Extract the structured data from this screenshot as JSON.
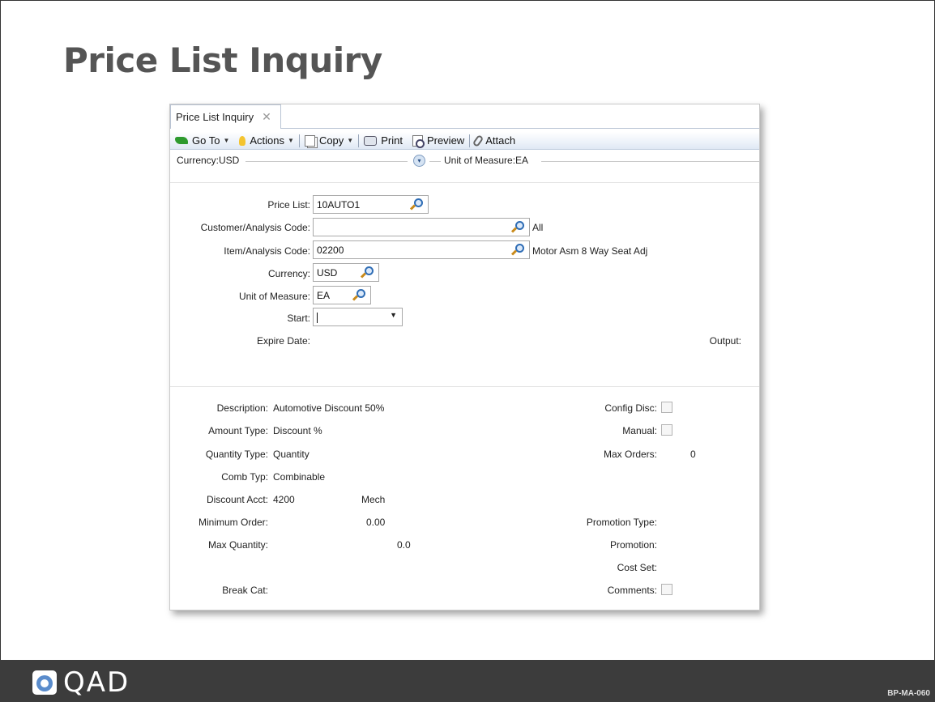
{
  "slide": {
    "title": "Price List Inquiry",
    "code": "BP-MA-060",
    "brand": "QAD"
  },
  "window": {
    "tab_label": "Price List Inquiry",
    "tab_close": "✕"
  },
  "toolbar": {
    "goto_label": "Go To",
    "actions_label": "Actions",
    "copy_label": "Copy",
    "print_label": "Print",
    "preview_label": "Preview",
    "attach_label": "Attach",
    "dropdown_glyph": "▼"
  },
  "header": {
    "currency_text": "Currency:USD",
    "uom_text": "Unit of Measure:EA",
    "expander_glyph": "▾"
  },
  "form": {
    "price_list": {
      "label": "Price List:",
      "value": "10AUTO1"
    },
    "customer": {
      "label": "Customer/Analysis Code:",
      "value": "",
      "desc": "All"
    },
    "item": {
      "label": "Item/Analysis Code:",
      "value": "02200",
      "desc": "Motor Asm 8 Way Seat Adj"
    },
    "currency": {
      "label": "Currency:",
      "value": "USD"
    },
    "uom": {
      "label": "Unit of Measure:",
      "value": "EA"
    },
    "start": {
      "label": "Start:",
      "value": ""
    },
    "expire_label": "Expire Date:",
    "output_label": "Output:"
  },
  "details": {
    "description": {
      "label": "Description:",
      "value": "Automotive Discount 50%"
    },
    "amount_type": {
      "label": "Amount Type:",
      "value": "Discount %"
    },
    "quantity_type": {
      "label": "Quantity Type:",
      "value": "Quantity"
    },
    "comb_typ": {
      "label": "Comb Typ:",
      "value": "Combinable"
    },
    "discount_acct": {
      "label": "Discount Acct:",
      "value": "4200",
      "sub": "Mech"
    },
    "minimum_order": {
      "label": "Minimum Order:",
      "value": "0.00"
    },
    "max_quantity": {
      "label": "Max Quantity:",
      "value": "0.0"
    },
    "break_cat": {
      "label": "Break Cat:"
    },
    "config_disc": {
      "label": "Config Disc:",
      "checked": false
    },
    "manual": {
      "label": "Manual:",
      "checked": false
    },
    "max_orders": {
      "label": "Max Orders:",
      "value": "0"
    },
    "promotion_type": {
      "label": "Promotion Type:"
    },
    "promotion": {
      "label": "Promotion:"
    },
    "cost_set": {
      "label": "Cost Set:"
    },
    "comments": {
      "label": "Comments:",
      "checked": false
    }
  }
}
